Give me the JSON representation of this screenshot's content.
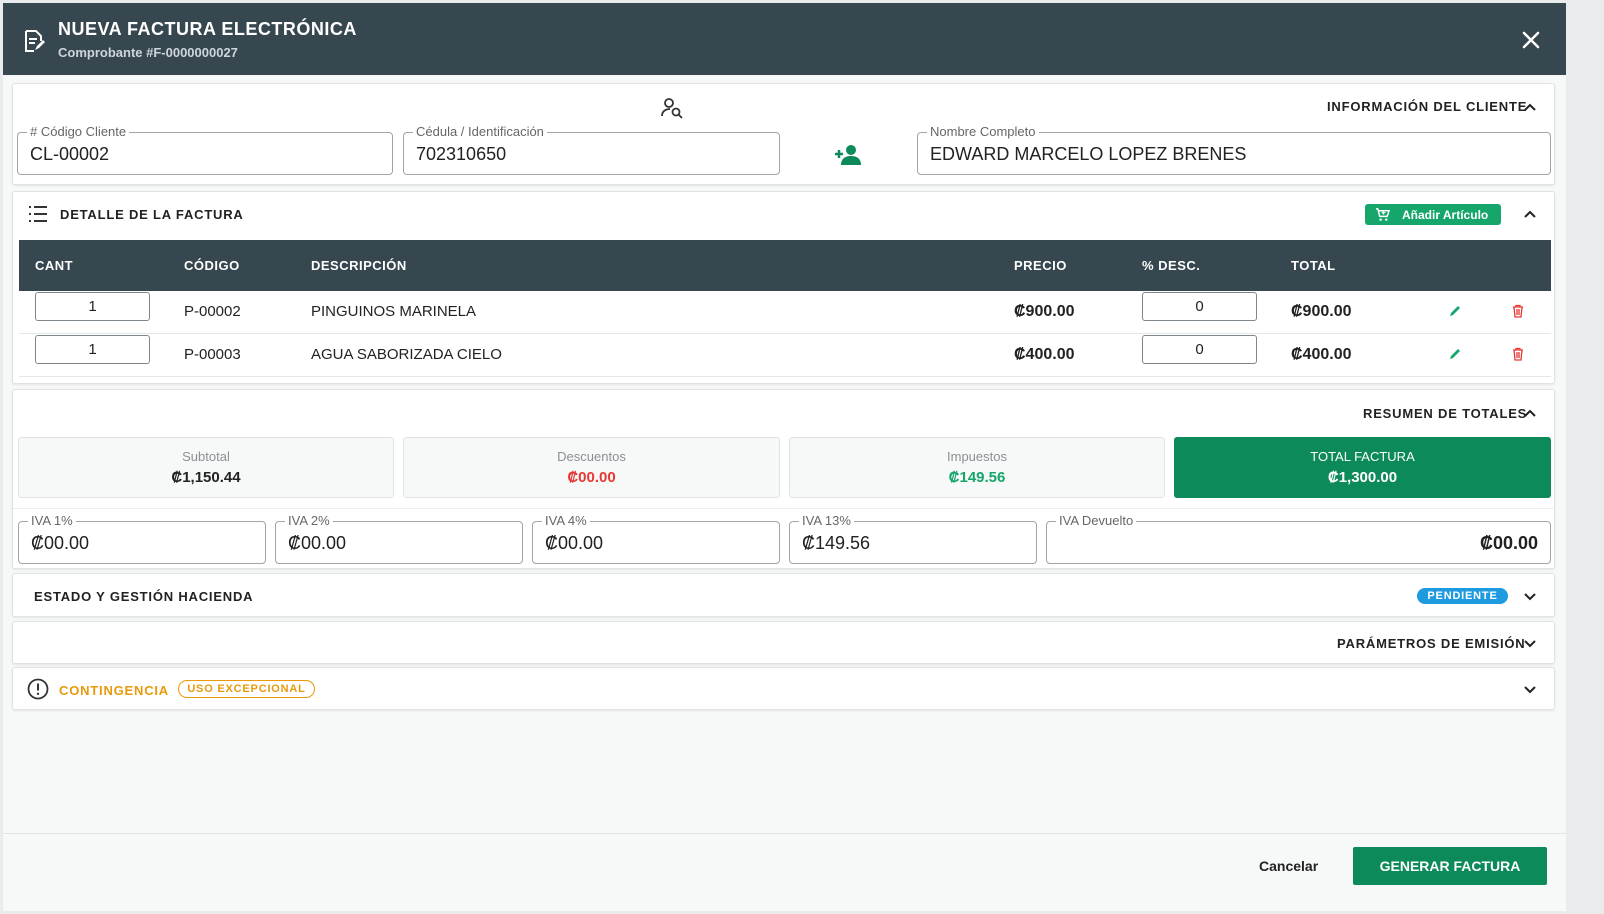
{
  "header": {
    "title": "NUEVA FACTURA ELECTRÓNICA",
    "subtitle": "Comprobante #F-0000000027",
    "close_icon": "close-icon"
  },
  "client": {
    "section_title": "INFORMACIÓN DEL CLIENTE",
    "code_label": "# Código Cliente",
    "code_value": "CL-00002",
    "id_label": "Cédula / Identificación",
    "id_value": "702310650",
    "name_label": "Nombre Completo",
    "name_value": "EDWARD MARCELO LOPEZ BRENES"
  },
  "detail": {
    "section_title": "DETALLE DE LA FACTURA",
    "add_button": "Añadir Artículo",
    "columns": [
      "CANT",
      "CÓDIGO",
      "DESCRIPCIÓN",
      "PRECIO",
      "% DESC.",
      "TOTAL"
    ],
    "rows": [
      {
        "qty": "1",
        "code": "P-00002",
        "description": "PINGUINOS MARINELA",
        "price": "₡900.00",
        "discount": "0",
        "total": "₡900.00"
      },
      {
        "qty": "1",
        "code": "P-00003",
        "description": "AGUA SABORIZADA CIELO",
        "price": "₡400.00",
        "discount": "0",
        "total": "₡400.00"
      }
    ]
  },
  "summary": {
    "section_title": "RESUMEN DE TOTALES",
    "subtotal_label": "Subtotal",
    "subtotal_value": "₡1,150.44",
    "discounts_label": "Descuentos",
    "discounts_value": "₡00.00",
    "taxes_label": "Impuestos",
    "taxes_value": "₡149.56",
    "total_label": "TOTAL FACTURA",
    "total_value": "₡1,300.00",
    "iva": [
      {
        "label": "IVA 1%",
        "value": "₡00.00"
      },
      {
        "label": "IVA 2%",
        "value": "₡00.00"
      },
      {
        "label": "IVA 4%",
        "value": "₡00.00"
      },
      {
        "label": "IVA 13%",
        "value": "₡149.56"
      }
    ],
    "iva_returned_label": "IVA Devuelto",
    "iva_returned_value": "₡00.00"
  },
  "hacienda": {
    "section_title": "ESTADO Y GESTIÓN HACIENDA",
    "status": "PENDIENTE"
  },
  "emission": {
    "section_title": "PARÁMETROS DE EMISIÓN"
  },
  "contingency": {
    "section_title": "CONTINGENCIA",
    "badge": "USO EXCEPCIONAL"
  },
  "footer": {
    "cancel": "Cancelar",
    "submit": "GENERAR FACTURA"
  },
  "colors": {
    "header_bg": "#37474f",
    "primary_green": "#0d8a5a",
    "accent_green": "#16a56a",
    "danger_red": "#e53935",
    "info_blue": "#1e9be0",
    "warning_orange": "#e89a0c"
  }
}
